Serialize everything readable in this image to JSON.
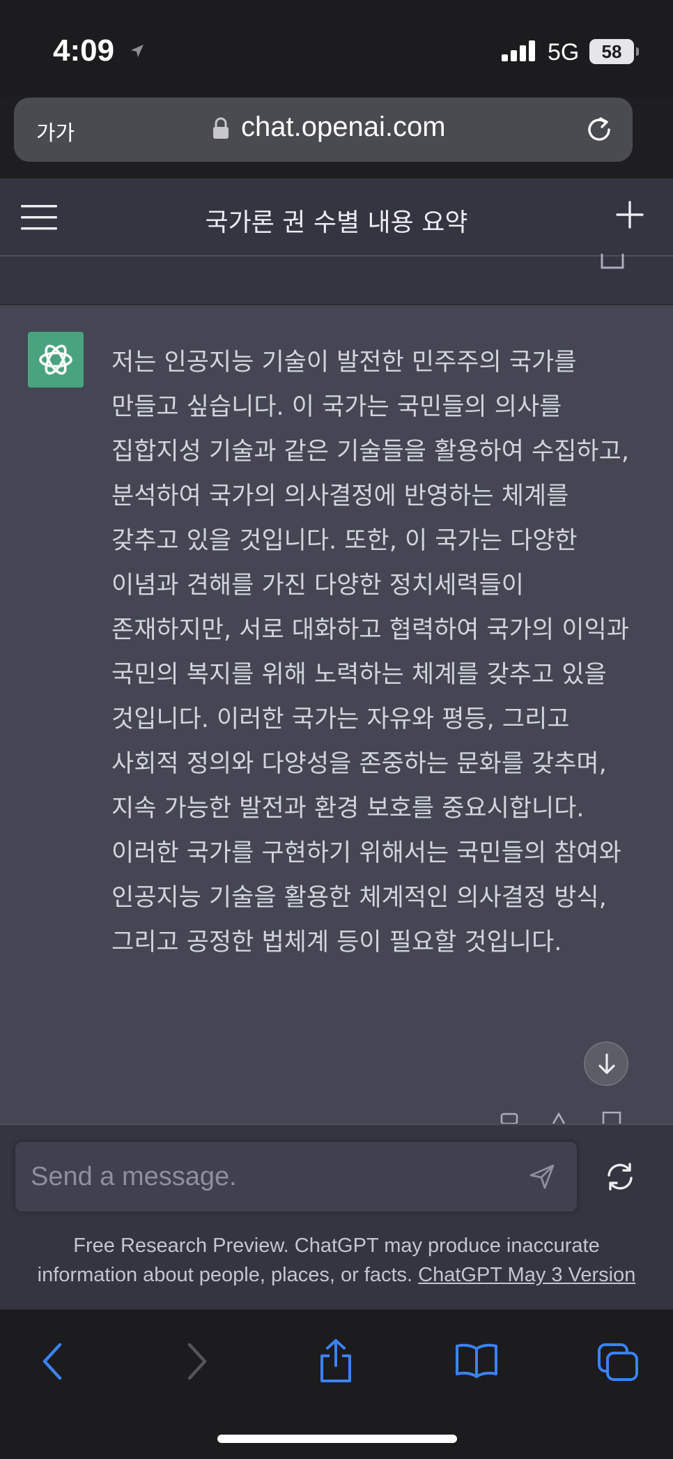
{
  "status_bar": {
    "time": "4:09",
    "network": "5G",
    "battery": "58"
  },
  "browser": {
    "text_size_label": "가가",
    "url": "chat.openai.com"
  },
  "header": {
    "title": "국가론 권 수별 내용 요약"
  },
  "message": {
    "text": "저는 인공지능 기술이 발전한 민주주의 국가를 만들고 싶습니다. 이 국가는 국민들의 의사를 집합지성 기술과 같은 기술들을 활용하여 수집하고, 분석하여 국가의 의사결정에 반영하는 체계를 갖추고 있을 것입니다. 또한, 이 국가는 다양한 이념과 견해를 가진 다양한 정치세력들이 존재하지만, 서로 대화하고 협력하여 국가의 이익과 국민의 복지를 위해 노력하는 체계를 갖추고 있을 것입니다. 이러한 국가는 자유와 평등, 그리고 사회적 정의와 다양성을 존중하는 문화를 갖추며, 지속 가능한 발전과 환경 보호를 중요시합니다. 이러한 국가를 구현하기 위해서는 국민들의 참여와 인공지능 기술을 활용한 체계적인 의사결정 방식, 그리고 공정한 법체계 등이 필요할 것입니다."
  },
  "composer": {
    "placeholder": "Send a message.",
    "disclaimer_line1": "Free Research Preview. ChatGPT may produce inaccurate",
    "disclaimer_line2": "information about people, places, or facts.",
    "version_link": "ChatGPT May 3 Version"
  },
  "colors": {
    "avatar_green": "#4aa37f",
    "header_bg": "#343541",
    "message_bg": "#444654",
    "safari_blue": "#3b82f6"
  }
}
